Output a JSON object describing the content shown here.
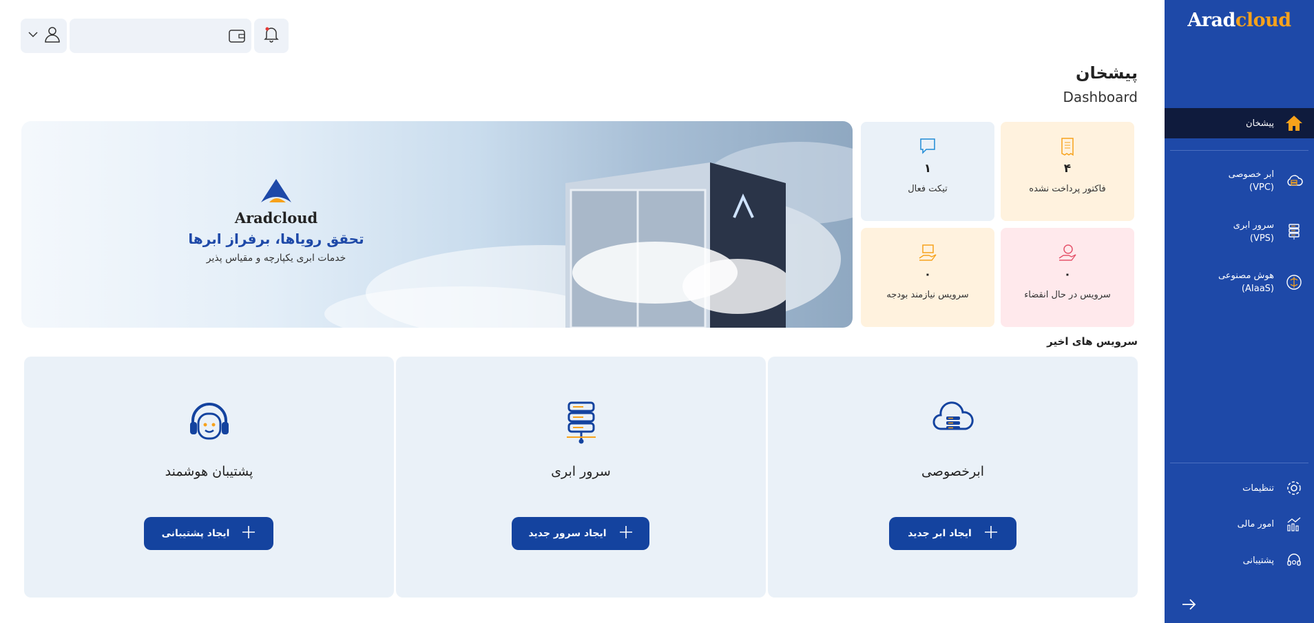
{
  "brand": {
    "part1": "Arad",
    "part2": "cloud"
  },
  "sidebar": {
    "active": {
      "label": "پیشخان",
      "icon": "home-icon"
    },
    "items": [
      {
        "label1": "ابر خصوصی",
        "label2": "(VPC)",
        "icon": "private-cloud-icon"
      },
      {
        "label1": "سرور ابری",
        "label2": "(VPS)",
        "icon": "server-icon"
      },
      {
        "label1": "هوش مصنوعی",
        "label2": "(AIaaS)",
        "icon": "ai-brain-icon"
      }
    ],
    "bottom": [
      {
        "label": "تنظیمات",
        "icon": "gear-icon"
      },
      {
        "label": "امور مالی",
        "icon": "finance-chart-icon"
      },
      {
        "label": "پشتیبانی",
        "icon": "support-headset-icon"
      }
    ]
  },
  "header": {
    "title": "پیشخان",
    "subtitle": "Dashboard"
  },
  "banner": {
    "brand": "Aradcloud",
    "headline": "تحقق رویاها، برفراز ابرها",
    "subline": "خدمات ابری یکپارچه و مقیاس پذیر"
  },
  "stats": [
    {
      "value": "۴",
      "label": "فاکتور پرداخت نشده",
      "bg": "#fff2de",
      "icon": "invoice-icon"
    },
    {
      "value": "۱",
      "label": "تیکت فعال",
      "bg": "#eaf1f8",
      "icon": "chat-icon"
    },
    {
      "value": "۰",
      "label": "سرویس در حال انقضاء",
      "bg": "#ffe9ec",
      "icon": "expiring-service-icon"
    },
    {
      "value": "۰",
      "label": "سرویس نیازمند بودجه",
      "bg": "#fff2de",
      "icon": "budget-box-icon"
    }
  ],
  "recent": {
    "title": "سرویس های اخیر",
    "cards": [
      {
        "title": "ابرخصوصی",
        "button": "ایجاد ابر جدید"
      },
      {
        "title": "سرور ابری",
        "button": "ایجاد سرور جدید"
      },
      {
        "title": "پشتیبان هوشمند",
        "button": "ایجاد پشتیبانی"
      }
    ]
  },
  "colors": {
    "primary": "#1e49a8",
    "accent": "#f7a21b",
    "dark": "#0f1b3d"
  }
}
